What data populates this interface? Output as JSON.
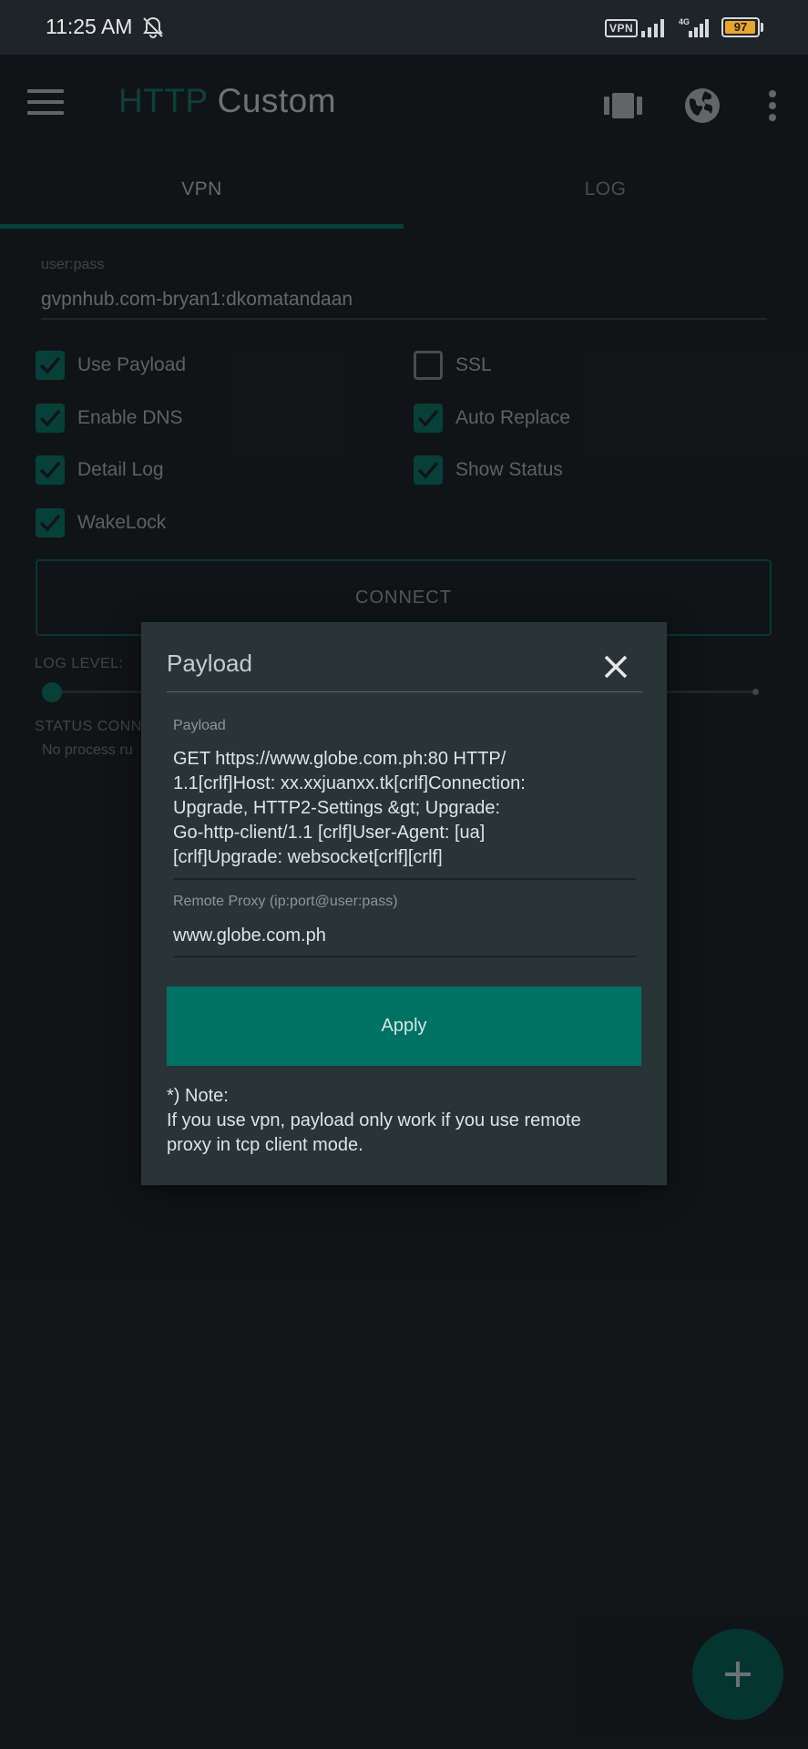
{
  "status_bar": {
    "time": "11:25 AM",
    "vpn_badge": "VPN",
    "network": "4G",
    "battery": "97",
    "battery_level": 0.97,
    "icons": [
      "bell-off-icon",
      "signal-icon",
      "signal-4g-icon",
      "battery-icon"
    ]
  },
  "app_bar": {
    "title_part1": "HTTP",
    "title_part2": "Custom",
    "title_part1_color": "#1b6d62",
    "icons": [
      "menu-icon",
      "presets-icon",
      "globe-icon",
      "more-vert-icon"
    ]
  },
  "tabs": [
    {
      "label": "VPN",
      "active": true
    },
    {
      "label": "LOG",
      "active": false
    }
  ],
  "form": {
    "user_pass_label": "user:pass",
    "user_pass_value": "gvpnhub.com-bryan1:dkomatandaan"
  },
  "options": [
    {
      "label": "Use Payload",
      "checked": true
    },
    {
      "label": "SSL",
      "checked": false
    },
    {
      "label": "Enable DNS",
      "checked": true
    },
    {
      "label": "Auto Replace",
      "checked": true
    },
    {
      "label": "Detail Log",
      "checked": true
    },
    {
      "label": "Show Status",
      "checked": true
    },
    {
      "label": "WakeLock",
      "checked": true
    }
  ],
  "connect_label": "CONNECT",
  "log_level_label": "LOG LEVEL:",
  "log_level_value": 0,
  "status_label": "STATUS CONN",
  "status_text": "No process ru",
  "fab_icon": "plus-icon",
  "accent_color": "#007265",
  "dialog": {
    "title": "Payload",
    "payload_label": "Payload",
    "payload_lines": [
      "GET  https://www.globe.com.ph:80 HTTP/",
      "1.1[crlf]Host: xx.xxjuanxx.tk[crlf]Connection:",
      "Upgrade, HTTP2-Settings  &gt; Upgrade:",
      "Go-http-client/1.1 [crlf]User-Agent: [ua]",
      "[crlf]Upgrade: websocket[crlf][crlf]"
    ],
    "proxy_label": "Remote Proxy (ip:port@user:pass)",
    "proxy_value": "www.globe.com.ph",
    "apply_label": "Apply",
    "note_lines": [
      "*) Note:",
      "If you use vpn, payload only work if you use remote",
      "proxy in tcp client mode."
    ]
  }
}
